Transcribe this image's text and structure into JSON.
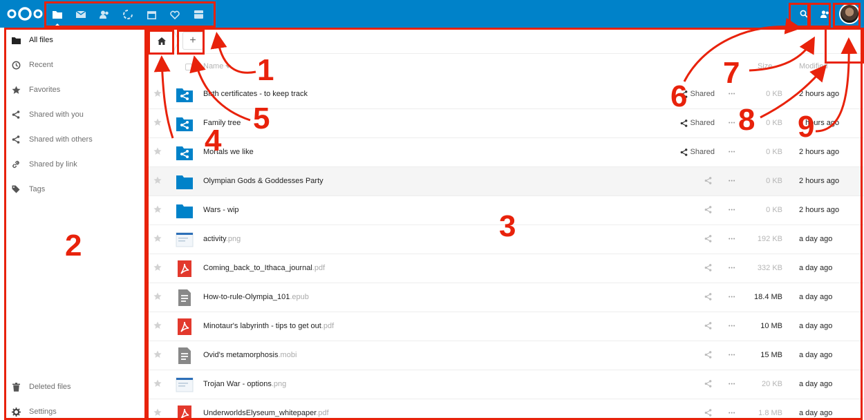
{
  "header": {
    "apps": [
      {
        "name": "files",
        "icon": "folder-icon"
      },
      {
        "name": "mail",
        "icon": "mail-icon"
      },
      {
        "name": "contacts",
        "icon": "contacts-icon"
      },
      {
        "name": "activity",
        "icon": "activity-icon"
      },
      {
        "name": "calendar",
        "icon": "calendar-icon"
      },
      {
        "name": "deck",
        "icon": "heart-icon"
      },
      {
        "name": "gallery",
        "icon": "gallery-icon"
      }
    ],
    "right": [
      "search-icon",
      "contacts-menu-icon",
      "avatar"
    ]
  },
  "sidebar": {
    "items": [
      {
        "label": "All files",
        "icon": "folder-icon"
      },
      {
        "label": "Recent",
        "icon": "clock-icon"
      },
      {
        "label": "Favorites",
        "icon": "star-icon"
      },
      {
        "label": "Shared with you",
        "icon": "share-icon"
      },
      {
        "label": "Shared with others",
        "icon": "share-icon"
      },
      {
        "label": "Shared by link",
        "icon": "link-icon"
      },
      {
        "label": "Tags",
        "icon": "tag-icon"
      }
    ],
    "bottom": [
      {
        "label": "Deleted files",
        "icon": "trash-icon"
      },
      {
        "label": "Settings",
        "icon": "gear-icon"
      }
    ]
  },
  "controls": {
    "new_label": "+"
  },
  "table": {
    "columns": {
      "name": "Name",
      "size": "Size",
      "modified": "Modified"
    },
    "rows": [
      {
        "name": "Birth certificates - to keep track",
        "ext": "",
        "type": "shared-folder",
        "share": "Shared",
        "size": "0 KB",
        "modified": "2 hours ago"
      },
      {
        "name": "Family tree",
        "ext": "",
        "type": "shared-folder",
        "share": "Shared",
        "size": "0 KB",
        "modified": "2 hours ago"
      },
      {
        "name": "Mortals we like",
        "ext": "",
        "type": "shared-folder",
        "share": "Shared",
        "size": "0 KB",
        "modified": "2 hours ago"
      },
      {
        "name": "Olympian Gods & Goddesses Party",
        "ext": "",
        "type": "folder",
        "share": "",
        "size": "0 KB",
        "modified": "2 hours ago"
      },
      {
        "name": "Wars - wip",
        "ext": "",
        "type": "folder",
        "share": "",
        "size": "0 KB",
        "modified": "2 hours ago"
      },
      {
        "name": "activity",
        "ext": ".png",
        "type": "image",
        "share": "",
        "size": "192 KB",
        "modified": "a day ago"
      },
      {
        "name": "Coming_back_to_Ithaca_journal",
        "ext": ".pdf",
        "type": "pdf",
        "share": "",
        "size": "332 KB",
        "modified": "a day ago"
      },
      {
        "name": "How-to-rule-Olympia_101",
        "ext": ".epub",
        "type": "doc",
        "share": "",
        "size": "18.4 MB",
        "modified": "a day ago"
      },
      {
        "name": "Minotaur's labyrinth - tips to get out",
        "ext": ".pdf",
        "type": "pdf",
        "share": "",
        "size": "10 MB",
        "modified": "a day ago"
      },
      {
        "name": "Ovid's metamorphosis",
        "ext": ".mobi",
        "type": "doc",
        "share": "",
        "size": "15 MB",
        "modified": "a day ago"
      },
      {
        "name": "Trojan War - options",
        "ext": ".png",
        "type": "image",
        "share": "",
        "size": "20 KB",
        "modified": "a day ago"
      },
      {
        "name": "UnderworldsElyseum_whitepaper",
        "ext": ".pdf",
        "type": "pdf",
        "share": "",
        "size": "1.8 MB",
        "modified": "a day ago"
      }
    ]
  },
  "annotations": {
    "labels": [
      "1",
      "2",
      "3",
      "4",
      "5",
      "6",
      "7",
      "8",
      "9"
    ],
    "color": "#e8220b"
  },
  "colors": {
    "brand": "#0082c9",
    "accent": "#e8220b"
  }
}
